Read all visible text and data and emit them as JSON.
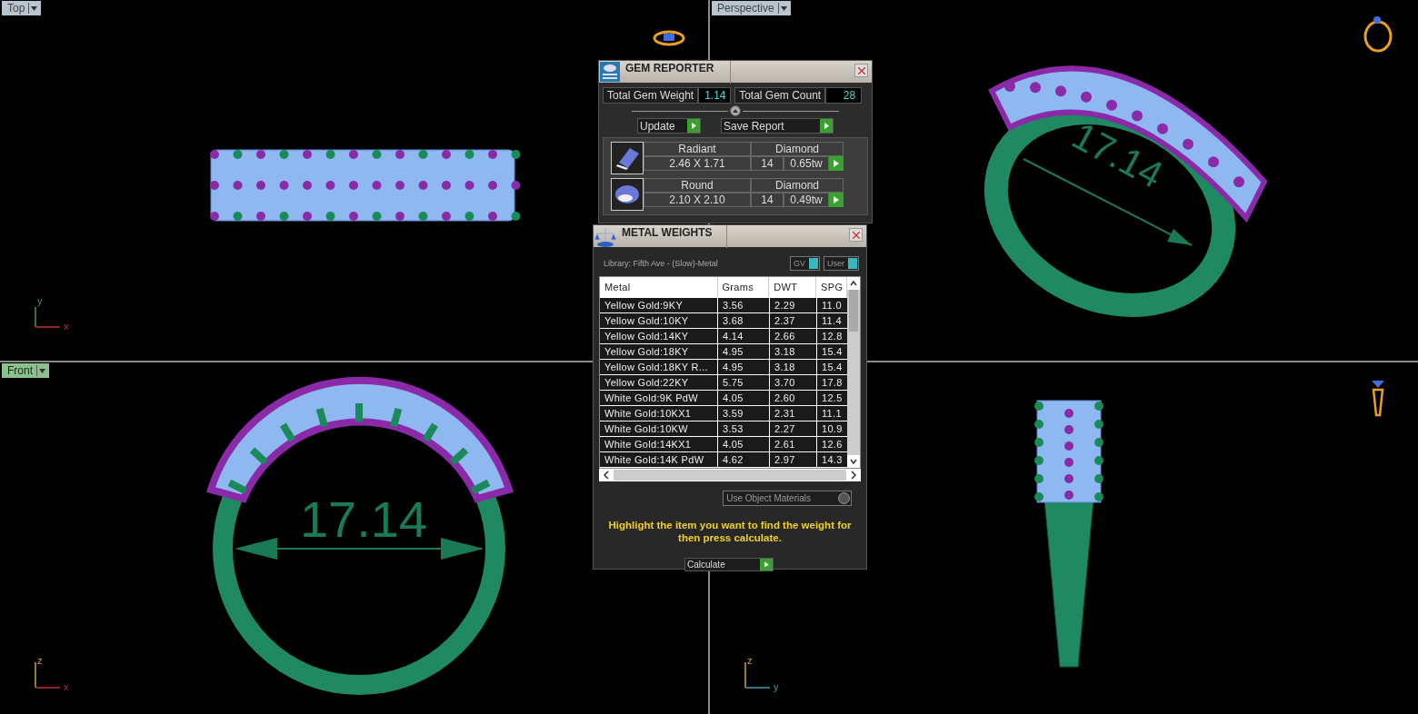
{
  "viewports": [
    {
      "label": "Top",
      "selected": false,
      "kind": "top",
      "axes": [
        "y",
        "x"
      ]
    },
    {
      "label": "Perspective",
      "selected": false,
      "kind": "perspective",
      "dimension": "17.14"
    },
    {
      "label": "Front",
      "selected": true,
      "kind": "front",
      "axes": [
        "z",
        "x"
      ],
      "dimension": "17.14"
    },
    {
      "kind": "side",
      "axes": [
        "z",
        "y"
      ]
    }
  ],
  "gem_reporter": {
    "title": "GEM REPORTER",
    "total_weight": {
      "label": "Total Gem Weight",
      "value": "1.14"
    },
    "total_count": {
      "label": "Total Gem Count",
      "value": "28"
    },
    "buttons": [
      "Update",
      "Save Report"
    ],
    "gems": [
      {
        "kind": "radiant",
        "shape": "Radiant",
        "material": "Diamond",
        "size": "2.46 X 1.71",
        "count": "14",
        "weight": "0.65tw"
      },
      {
        "kind": "round",
        "shape": "Round",
        "material": "Diamond",
        "size": "2.10 X 2.10",
        "count": "14",
        "weight": "0.49tw"
      }
    ]
  },
  "metal_weights": {
    "title": "METAL WEIGHTS",
    "library": "Library: Fifth Ave - (Slow)-Metal",
    "toggles": [
      {
        "label": "GV",
        "on": true
      },
      {
        "label": "User",
        "on": true
      }
    ],
    "columns": [
      "Metal",
      "Grams",
      "DWT",
      "SPG"
    ],
    "rows": [
      [
        "Yellow Gold:9KY",
        "3.56",
        "2.29",
        "11.0"
      ],
      [
        "Yellow Gold:10KY",
        "3.68",
        "2.37",
        "11.4"
      ],
      [
        "Yellow Gold:14KY",
        "4.14",
        "2.66",
        "12.8"
      ],
      [
        "Yellow Gold:18KY",
        "4.95",
        "3.18",
        "15.4"
      ],
      [
        "Yellow Gold:18KY R...",
        "4.95",
        "3.18",
        "15.4"
      ],
      [
        "Yellow Gold:22KY",
        "5.75",
        "3.70",
        "17.8"
      ],
      [
        "White Gold:9K PdW",
        "4.05",
        "2.60",
        "12.5"
      ],
      [
        "White Gold:10KX1",
        "3.59",
        "2.31",
        "11.1"
      ],
      [
        "White Gold:10KW",
        "3.53",
        "2.27",
        "10.9"
      ],
      [
        "White Gold:14KX1",
        "4.05",
        "2.61",
        "12.6"
      ],
      [
        "White Gold:14K PdW",
        "4.62",
        "2.97",
        "14.3"
      ]
    ],
    "use_object_materials": {
      "label": "Use Object Materials",
      "on": false
    },
    "message": "Highlight the item you want to find the weight for then press calculate.",
    "button": "Calculate"
  }
}
